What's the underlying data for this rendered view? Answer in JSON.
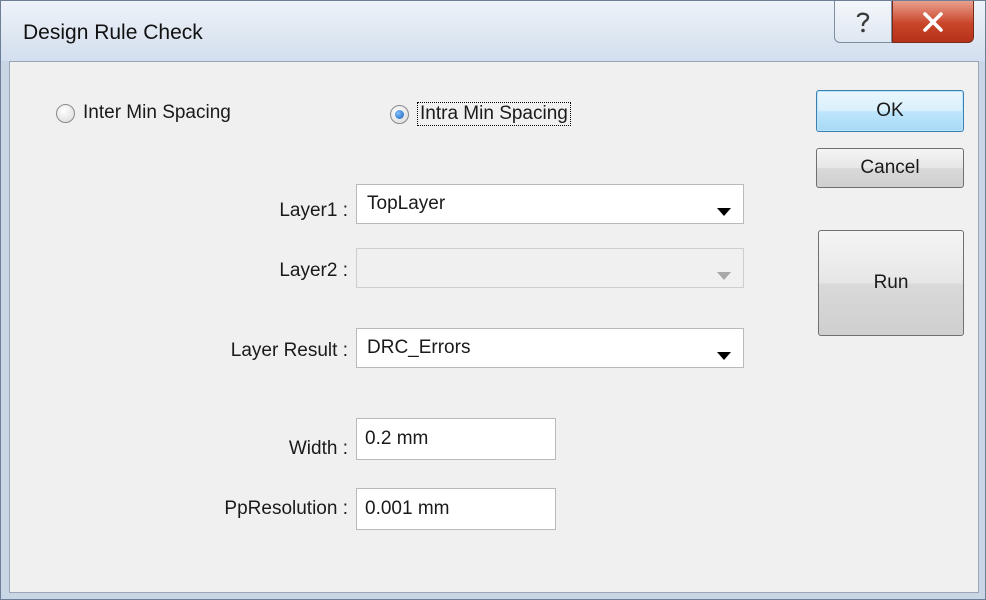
{
  "window": {
    "title": "Design Rule Check",
    "help_icon": "question-mark-icon",
    "close_icon": "close-x-icon"
  },
  "spacing_mode": {
    "inter_label": "Inter Min Spacing",
    "intra_label": "Intra Min Spacing",
    "selected": "intra"
  },
  "fields": {
    "layer1_label": "Layer1 :",
    "layer1_value": "TopLayer",
    "layer2_label": "Layer2 :",
    "layer2_value": "",
    "layer_result_label": "Layer Result :",
    "layer_result_value": "DRC_Errors",
    "width_label": "Width :",
    "width_value": "0.2 mm",
    "ppresolution_label": "PpResolution :",
    "ppresolution_value": "0.001 mm"
  },
  "buttons": {
    "ok_label": "OK",
    "cancel_label": "Cancel",
    "run_label": "Run"
  },
  "colors": {
    "close_button": "#c9452a",
    "default_button_border": "#3c7fb1",
    "radio_selected": "#1b5fb3"
  }
}
